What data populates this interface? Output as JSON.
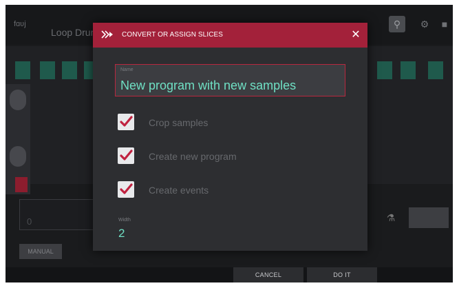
{
  "background": {
    "app_logo": "fɑʋj",
    "app_title": "Loop Drum",
    "icons": {
      "search": "search-icon",
      "settings": "gear-icon",
      "menu": "menu-icon"
    },
    "manual_label": "MANUAL"
  },
  "dialog": {
    "title": "CONVERT OR ASSIGN SLICES",
    "icon": "slice-arrow-icon",
    "close_icon": "close-icon",
    "name_field": {
      "label": "Name",
      "value": "New program with new samples"
    },
    "options": [
      {
        "label": "Crop samples",
        "checked": true
      },
      {
        "label": "Create new program",
        "checked": true
      },
      {
        "label": "Create events",
        "checked": true
      }
    ],
    "width": {
      "label": "Width",
      "value": "2"
    }
  },
  "footer": {
    "cancel_label": "CANCEL",
    "doit_label": "DO IT"
  },
  "colors": {
    "accent_red": "#a3213a",
    "value_teal": "#6fe0c4",
    "checkbox_red": "#c0213f",
    "dialog_bg": "#2d2e31"
  }
}
